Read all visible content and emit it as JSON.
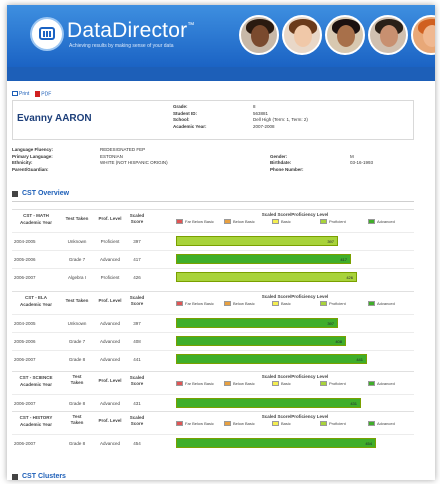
{
  "brand": {
    "name": "DataDirector",
    "mark": "™",
    "tagline": "Achieving results by making sense of your data"
  },
  "toolbar": {
    "print": "Print",
    "pdf": "PDF"
  },
  "student": {
    "name": "Evanny AARON",
    "fields": [
      {
        "label": "Grade:",
        "value": "8"
      },
      {
        "label": "Student ID:",
        "value": "563881"
      },
      {
        "label": "School:",
        "value": "Dell High (Term: 1, Term: 2)"
      },
      {
        "label": "Academic Year:",
        "value": "2007-2008"
      }
    ]
  },
  "demographics": [
    {
      "l1": "Language Fluency:",
      "v1": "REDESIGNATED FEP",
      "l2": "",
      "v2": ""
    },
    {
      "l1": "Primary Language:",
      "v1": "ESTONIAN",
      "l2": "Gender:",
      "v2": "M"
    },
    {
      "l1": "Ethnicity:",
      "v1": "WHITE (NOT HISPANIC ORIGIN)",
      "l2": "Birthdate:",
      "v2": "03-16-1993"
    },
    {
      "l1": "Parent/Guardian:",
      "v1": "",
      "l2": "Phone Number:",
      "v2": ""
    }
  ],
  "sections": {
    "overview": "CST Overview",
    "clusters": "CST Clusters"
  },
  "headers": {
    "test_taken": "Test Taken",
    "test_taken_split": [
      "Test",
      "Taken"
    ],
    "prof_level": "Prof. Level",
    "scaled_score": [
      "Scaled",
      "Score"
    ],
    "legend_title": "Scaled Score/Proficiency Level",
    "academic_year": "Academic Year"
  },
  "legend": [
    {
      "label": "Far Below Basic",
      "color": "#e05555"
    },
    {
      "label": "Below Basic",
      "color": "#e8a040"
    },
    {
      "label": "Basic",
      "color": "#f4ee50"
    },
    {
      "label": "Proficient",
      "color": "#a8d33a"
    },
    {
      "label": "Advanced",
      "color": "#3fae2a"
    }
  ],
  "cst": [
    {
      "subject": "CST - MATH",
      "rows": [
        {
          "year": "2004-2005",
          "test": "Unknown",
          "level": "Proficient",
          "score": 397
        },
        {
          "year": "2005-2006",
          "test": "Grade 7",
          "level": "Advanced",
          "score": 417
        },
        {
          "year": "2006-2007",
          "test": "Algebra I",
          "level": "Proficient",
          "score": 426
        }
      ]
    },
    {
      "subject": "CST - ELA",
      "rows": [
        {
          "year": "2004-2005",
          "test": "Unknown",
          "level": "Advanced",
          "score": 397
        },
        {
          "year": "2005-2006",
          "test": "Grade 7",
          "level": "Advanced",
          "score": 408
        },
        {
          "year": "2006-2007",
          "test": "Grade 8",
          "level": "Advanced",
          "score": 441
        }
      ]
    },
    {
      "subject": "CST - SCIENCE",
      "rows": [
        {
          "year": "2006-2007",
          "test": "Grade 8",
          "level": "Advanced",
          "score": 431
        }
      ]
    },
    {
      "subject": "CST - HISTORY",
      "rows": [
        {
          "year": "2006-2007",
          "test": "Grade 8",
          "level": "Advanced",
          "score": 454
        }
      ]
    }
  ],
  "colors": {
    "proficient": "#a8d33a",
    "advanced": "#3fae2a"
  }
}
